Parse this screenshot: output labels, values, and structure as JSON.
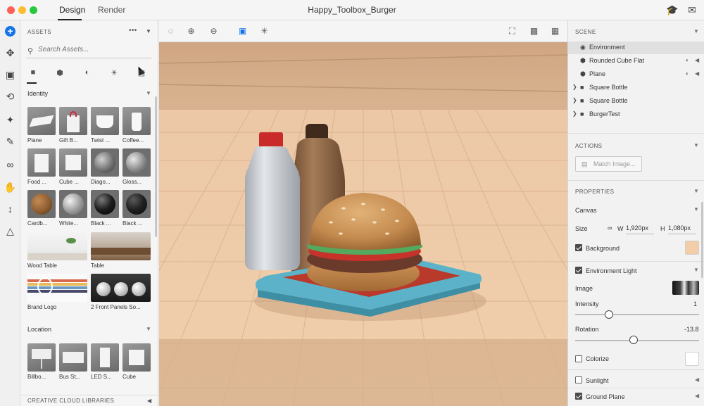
{
  "titlebar": {
    "tabs": [
      {
        "label": "Design"
      },
      {
        "label": "Render"
      }
    ],
    "title": "Happy_Toolbox_Burger",
    "icons": [
      "learn-icon",
      "feedback-icon"
    ]
  },
  "toolrail": {
    "tools": [
      "add-icon",
      "select-icon",
      "frame-icon",
      "orbit-icon",
      "magic-wand-icon",
      "eyedropper-icon",
      "link-icon",
      "pan-icon",
      "dolly-icon",
      "perspective-icon"
    ]
  },
  "assets": {
    "header": "ASSETS",
    "more": "•••",
    "search": {
      "placeholder": "Search Assets..."
    },
    "category_tabs": [
      "models-icon",
      "materials-icon",
      "lights-icon",
      "backgrounds-icon",
      "images-icon"
    ],
    "sections": [
      {
        "label": "Identity",
        "items": [
          {
            "label": "Plane"
          },
          {
            "label": "Gift B..."
          },
          {
            "label": "Twist ..."
          },
          {
            "label": "Coffee..."
          },
          {
            "label": "Food ..."
          },
          {
            "label": "Cube ..."
          },
          {
            "label": "Diago..."
          },
          {
            "label": "Gloss..."
          },
          {
            "label": "Cardb..."
          },
          {
            "label": "White..."
          },
          {
            "label": "Black ..."
          },
          {
            "label": "Black ..."
          }
        ],
        "wide_items": [
          {
            "label": "Wood Table"
          },
          {
            "label": "Table"
          },
          {
            "label": "Brand Logo"
          },
          {
            "label": "2 Front Panels So..."
          }
        ]
      },
      {
        "label": "Location",
        "items": [
          {
            "label": "Billbo..."
          },
          {
            "label": "Bus St..."
          },
          {
            "label": "LED S..."
          },
          {
            "label": "Cube"
          }
        ]
      }
    ],
    "footer": "CREATIVE CLOUD LIBRARIES"
  },
  "viewport": {
    "toolbar_left": [
      "marquee-select-icon",
      "add-to-selection-icon",
      "subtract-selection-icon",
      "frame-selection-icon",
      "transform-icon"
    ],
    "toolbar_right": [
      "fit-icon",
      "camera-bookmark-icon",
      "render-preview-icon"
    ]
  },
  "scene": {
    "header": "SCENE",
    "items": [
      {
        "name": "Environment",
        "icon": "globe-icon",
        "selected": true,
        "expandable": false
      },
      {
        "name": "Rounded Cube Flat",
        "icon": "model-icon",
        "selected": false,
        "expandable": false
      },
      {
        "name": "Plane",
        "icon": "model-icon",
        "selected": false,
        "expandable": false
      },
      {
        "name": "Square Bottle",
        "icon": "folder-icon",
        "selected": false,
        "expandable": true
      },
      {
        "name": "Square Bottle",
        "icon": "folder-icon",
        "selected": false,
        "expandable": true
      },
      {
        "name": "BurgerTest",
        "icon": "folder-icon",
        "selected": false,
        "expandable": true
      }
    ]
  },
  "actions": {
    "header": "ACTIONS",
    "match_image": "Match Image..."
  },
  "properties": {
    "header": "PROPERTIES",
    "canvas": {
      "label": "Canvas",
      "size_label": "Size",
      "w_label": "W",
      "w_value": "1,920px",
      "h_label": "H",
      "h_value": "1,080px",
      "background_label": "Background",
      "background_checked": true,
      "background_color": "#f3cda7"
    },
    "environment_light": {
      "label": "Environment Light",
      "checked": true,
      "image_label": "Image",
      "intensity_label": "Intensity",
      "intensity_value": "1",
      "intensity_fraction": 0.27,
      "rotation_label": "Rotation",
      "rotation_value": "-13.8",
      "rotation_fraction": 0.47,
      "colorize_label": "Colorize",
      "colorize_checked": false
    },
    "sunlight": {
      "label": "Sunlight",
      "checked": false
    },
    "ground_plane": {
      "label": "Ground Plane",
      "checked": true
    }
  },
  "colors": {
    "accent": "#1473e6",
    "floor": "#e9c3a0",
    "tray": "#5cb3c9",
    "tray_mat": "#b9392b"
  }
}
